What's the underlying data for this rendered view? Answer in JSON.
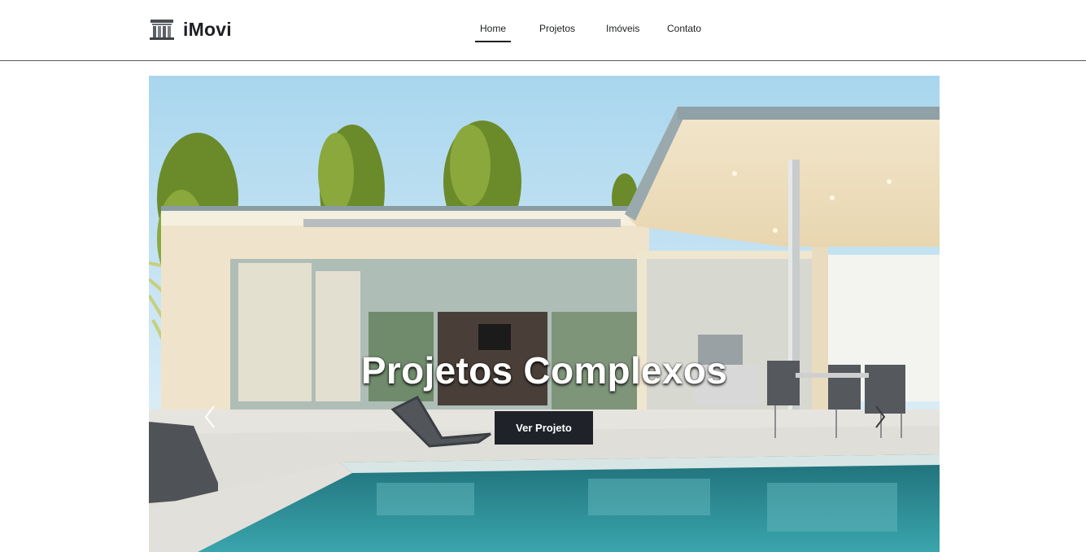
{
  "brand": {
    "name": "iMovi",
    "logo_icon": "building-icon"
  },
  "nav": {
    "items": [
      {
        "label": "Home",
        "active": true
      },
      {
        "label": "Projetos",
        "active": false
      },
      {
        "label": "Imóveis",
        "active": false
      },
      {
        "label": "Contato",
        "active": false
      }
    ]
  },
  "hero": {
    "title": "Projetos Complexos",
    "button_label": "Ver Projeto",
    "prev_icon": "chevron-left-icon",
    "next_icon": "chevron-right-icon",
    "image": "modern-house-with-pool"
  },
  "colors": {
    "text_dark": "#1d1f22",
    "button_bg": "#1f2228",
    "nav_border": "#5a5a5a",
    "sky": "#cfe6f3",
    "pool": "#2e8b93"
  }
}
